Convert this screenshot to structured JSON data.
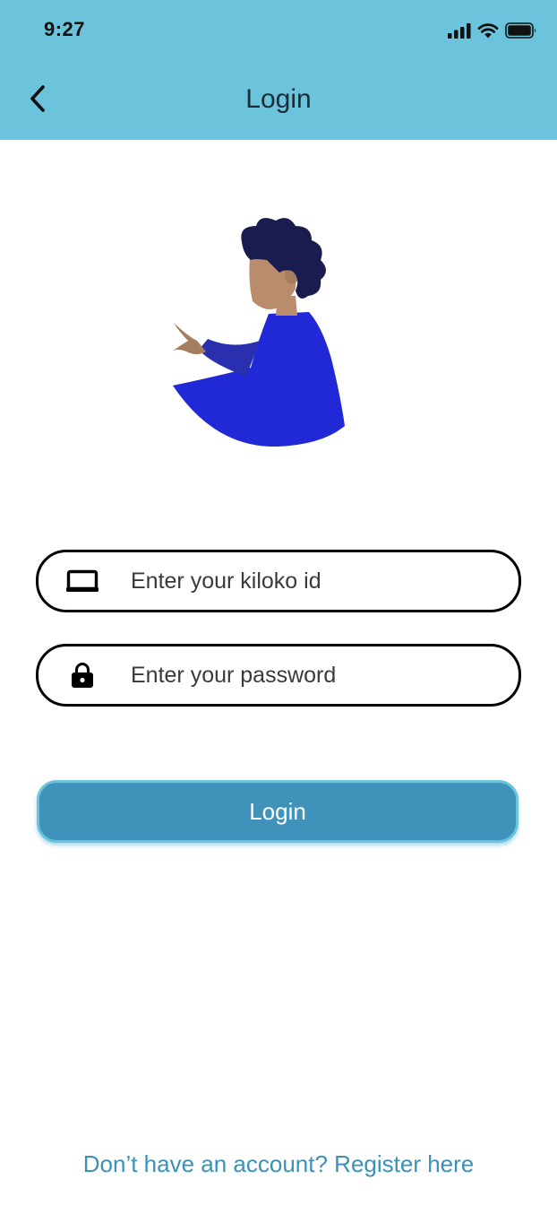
{
  "status_bar": {
    "time": "9:27",
    "icons": [
      "signal-icon",
      "wifi-icon",
      "battery-icon"
    ]
  },
  "header": {
    "title": "Login",
    "back_icon": "chevron-left-icon",
    "background": "#6cc3dc"
  },
  "form": {
    "id_field": {
      "icon": "laptop-icon",
      "placeholder": "Enter your kiloko id",
      "value": ""
    },
    "password_field": {
      "icon": "lock-icon",
      "placeholder": "Enter your password",
      "value": ""
    },
    "login_button_label": "Login",
    "login_button_color": "#3f92b9"
  },
  "footer": {
    "register_text": "Don’t have an account? Register here",
    "link_color": "#3a92b7"
  }
}
